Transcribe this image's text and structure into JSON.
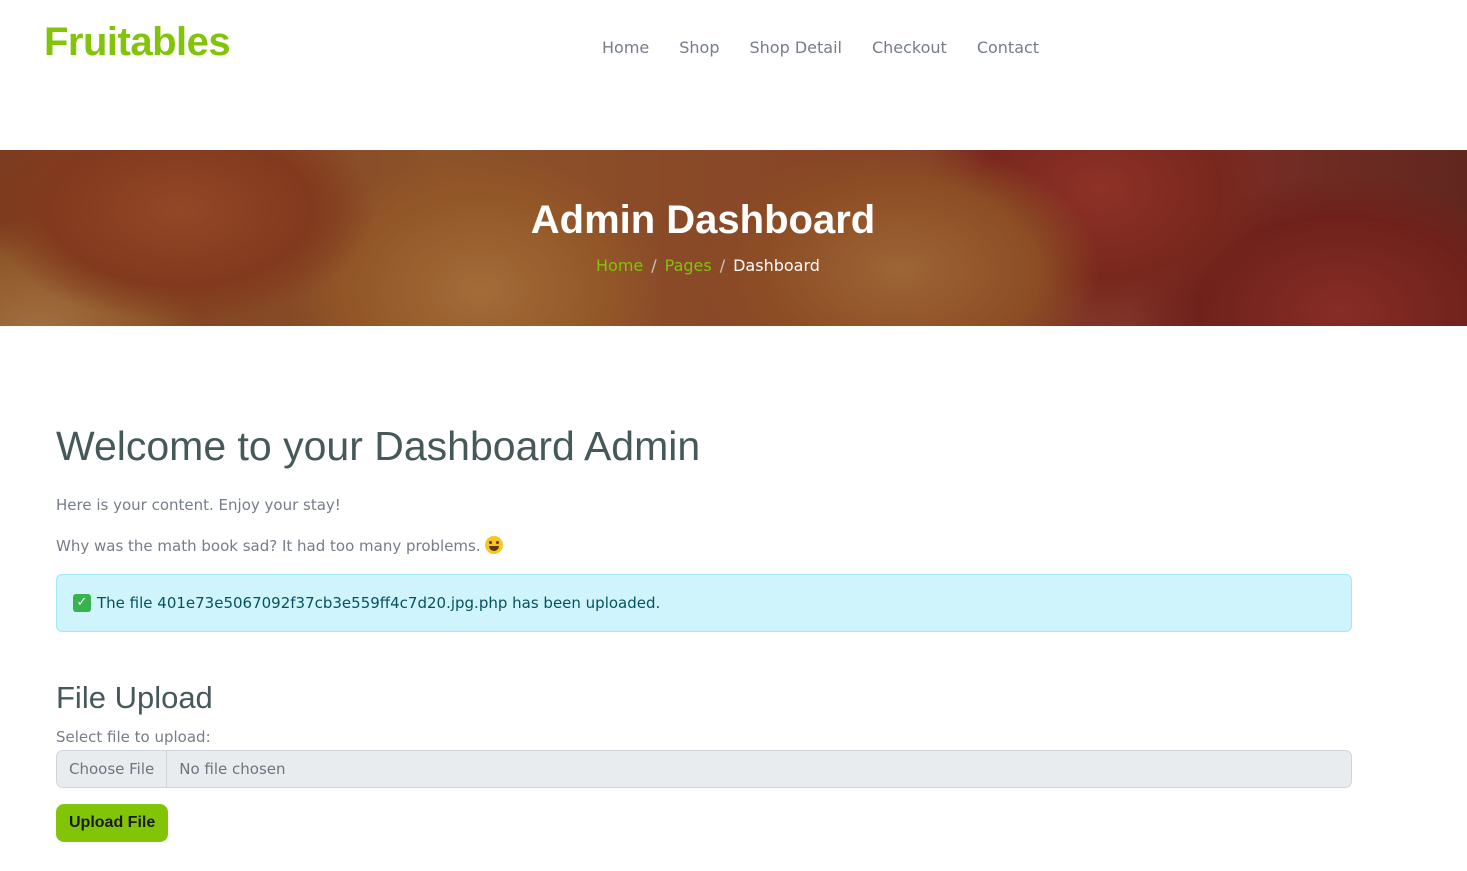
{
  "brand": "Fruitables",
  "nav": {
    "items": [
      "Home",
      "Shop",
      "Shop Detail",
      "Checkout",
      "Contact"
    ]
  },
  "hero": {
    "title": "Admin Dashboard",
    "breadcrumb": {
      "home": "Home",
      "pages": "Pages",
      "current": "Dashboard",
      "separator": "/"
    }
  },
  "main": {
    "welcome": "Welcome to your Dashboard Admin",
    "intro": "Here is your content. Enjoy your stay!",
    "joke": "Why was the math book sad? It had too many problems.",
    "alert": {
      "icon": "✓",
      "message": "The file 401e73e5067092f37cb3e559ff4c7d20.jpg.php has been uploaded."
    },
    "upload": {
      "title": "File Upload",
      "label": "Select file to upload:",
      "choose_label": "Choose File",
      "no_file_label": "No file chosen",
      "button_label": "Upload File"
    }
  },
  "colors": {
    "accent": "#81c408",
    "heading": "#45595b",
    "text": "#747d88",
    "alert_bg": "#cff4fc",
    "alert_text": "#055160"
  }
}
